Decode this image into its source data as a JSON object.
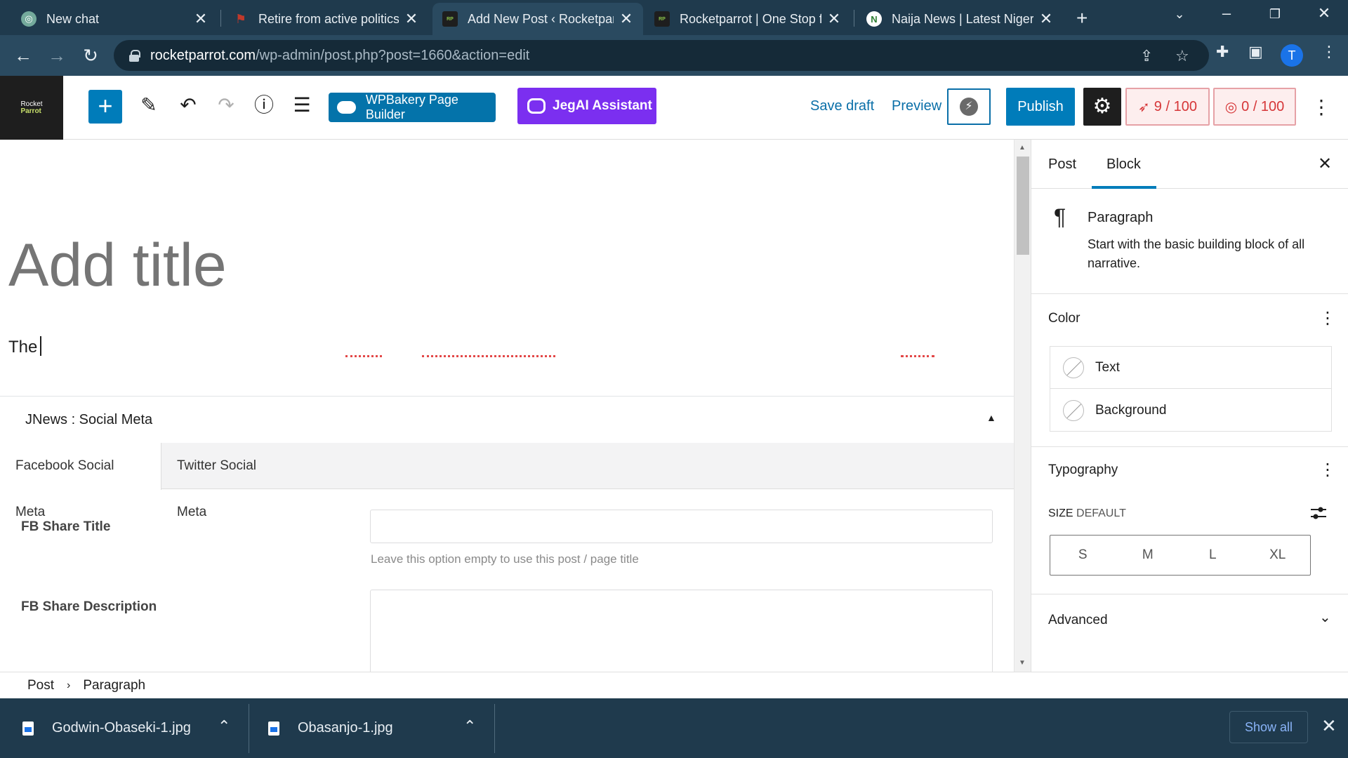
{
  "browser": {
    "tabs": [
      {
        "title": "New chat",
        "favicon": "chatgpt-icon",
        "color": "#74aa9c"
      },
      {
        "title": "Retire from active politics",
        "favicon": "flag-icon",
        "color": "#c0392b"
      },
      {
        "title": "Add New Post ‹ Rocketparrot",
        "favicon": "rocketparrot-icon",
        "color": "#8bc34a"
      },
      {
        "title": "Rocketparrot | One Stop for",
        "favicon": "rocketparrot-icon",
        "color": "#8bc34a"
      },
      {
        "title": "Naija News | Latest Nigerian",
        "favicon": "naija-news-icon",
        "color": "#2e7d32"
      }
    ],
    "url_host": "rocketparrot.com",
    "url_path": "/wp-admin/post.php?post=1660&action=edit",
    "profile_initial": "T"
  },
  "editor_header": {
    "site_logo_line1": "Rocket",
    "site_logo_line2": "Parrot",
    "wpbakery_label": "WPBakery Page Builder",
    "jegai_label": "JegAI Assistant",
    "save_draft": "Save draft",
    "preview": "Preview",
    "publish": "Publish",
    "seo_score": "9 / 100",
    "readability_score": "0 / 100"
  },
  "canvas": {
    "title_placeholder": "Add title",
    "paragraph_text": "The"
  },
  "social_meta": {
    "heading": "JNews : Social Meta",
    "tabs": [
      "Facebook Social Meta",
      "Twitter Social Meta"
    ],
    "fb_share_title_label": "FB Share Title",
    "fb_share_title_help": "Leave this option empty to use this post / page title",
    "fb_share_description_label": "FB Share Description"
  },
  "sidebar": {
    "tabs": [
      "Post",
      "Block"
    ],
    "active_tab": "Block",
    "block_name": "Paragraph",
    "block_description": "Start with the basic building block of all narrative.",
    "color_title": "Color",
    "color_options": [
      "Text",
      "Background"
    ],
    "typography_title": "Typography",
    "size_label": "SIZE",
    "size_value": "DEFAULT",
    "size_options": [
      "S",
      "M",
      "L",
      "XL"
    ],
    "advanced_title": "Advanced"
  },
  "breadcrumb": [
    "Post",
    "Paragraph"
  ],
  "downloads": {
    "files": [
      "Godwin-Obaseki-1.jpg",
      "Obasanjo-1.jpg"
    ],
    "show_all": "Show all"
  },
  "colors": {
    "wp_blue": "#007cba",
    "jegai_purple": "#7b2ff0",
    "chrome_dark": "#1f3a4d",
    "score_red": "#d63638"
  }
}
